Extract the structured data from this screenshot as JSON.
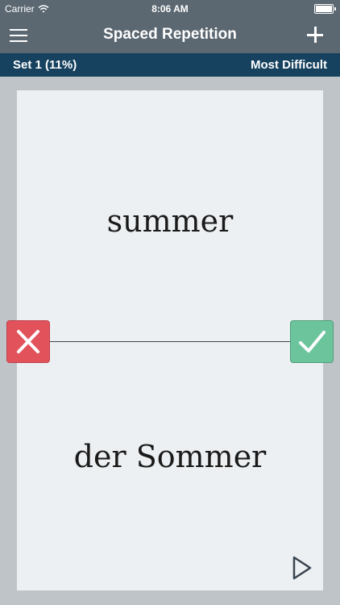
{
  "status_bar": {
    "carrier": "Carrier",
    "time": "8:06 AM"
  },
  "nav": {
    "title": "Spaced Repetition",
    "menu_icon": "menu-icon",
    "add_icon": "plus-icon"
  },
  "set_bar": {
    "set_label": "Set 1 (11%)",
    "filter_label": "Most Difficult"
  },
  "card": {
    "front": "summer",
    "back": "der Sommer"
  },
  "actions": {
    "wrong_icon": "x-icon",
    "right_icon": "checkmark-icon",
    "play_icon": "play-icon"
  },
  "colors": {
    "header": "#5b6771",
    "set_bar": "#17425f",
    "wrong": "#e2525b",
    "right": "#6cc49d",
    "card": "#edf0f2"
  }
}
